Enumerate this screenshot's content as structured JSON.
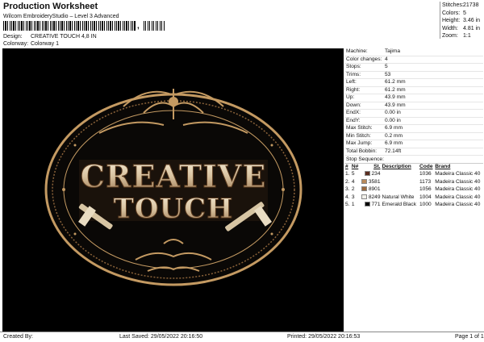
{
  "header": {
    "title": "Production Worksheet",
    "subtitle": "Wilcom EmbroideryStudio – Level 3 Advanced",
    "barcode_separator": ",",
    "design_label": "Design:",
    "design_value": "CREATIVE TOUCH 4,8 IN",
    "colorway_label": "Colorway:",
    "colorway_value": "Colorway 1"
  },
  "stats": [
    {
      "label": "Stitches:",
      "value": "21738"
    },
    {
      "label": "Colors:",
      "value": "5"
    },
    {
      "label": "Height:",
      "value": "3.46 in"
    },
    {
      "label": "Width:",
      "value": "4.81 in"
    },
    {
      "label": "Zoom:",
      "value": "1:1"
    }
  ],
  "design_image": {
    "line1": "CREATIVE",
    "line2": "TOUCH",
    "background": "#000000",
    "gold": "#c49a62",
    "cream": "#efe3c8"
  },
  "machine_info": [
    {
      "label": "Machine:",
      "value": "Tajima"
    },
    {
      "label": "Color changes:",
      "value": "4"
    },
    {
      "label": "Stops:",
      "value": "5"
    },
    {
      "label": "Trims:",
      "value": "53"
    },
    {
      "label": "Left:",
      "value": "61.2 mm"
    },
    {
      "label": "Right:",
      "value": "61.2 mm"
    },
    {
      "label": "Up:",
      "value": "43.9 mm"
    },
    {
      "label": "Down:",
      "value": "43.9 mm"
    },
    {
      "label": "EndX:",
      "value": "0.00 in"
    },
    {
      "label": "EndY:",
      "value": "0.00 in"
    },
    {
      "label": "Max Stitch:",
      "value": "6.9 mm"
    },
    {
      "label": "Min Stitch:",
      "value": "0.2 mm"
    },
    {
      "label": "Max Jump:",
      "value": "6.9 mm"
    },
    {
      "label": "Total Bobbin:",
      "value": "72.14ft"
    }
  ],
  "stop_sequence": {
    "label": "Stop Sequence:",
    "headers": [
      "#",
      "N#",
      "St.",
      "Description",
      "Code",
      "Brand"
    ],
    "rows": [
      {
        "num": "1.",
        "n": "5",
        "color": "#5a2d20",
        "st": "234",
        "desc": "",
        "code": "1036",
        "brand": "Madeira Classic 40"
      },
      {
        "num": "2.",
        "n": "4",
        "color": "#b98a5b",
        "st": "3581",
        "desc": "",
        "code": "1173",
        "brand": "Madeira Classic 40"
      },
      {
        "num": "3.",
        "n": "2",
        "color": "#9c6a3f",
        "st": "8901",
        "desc": "",
        "code": "1056",
        "brand": "Madeira Classic 40"
      },
      {
        "num": "4.",
        "n": "3",
        "color": "#f1f0ea",
        "st": "8249",
        "desc": "Natural White",
        "code": "1004",
        "brand": "Madeira Classic 40"
      },
      {
        "num": "5.",
        "n": "1",
        "color": "#050505",
        "st": "771",
        "desc": "Emerald Black",
        "code": "1000",
        "brand": "Madeira Classic 40"
      }
    ]
  },
  "footer": {
    "created_by": "Created By:",
    "last_saved": "Last Saved: 29/05/2022 20:16:50",
    "printed": "Printed: 29/05/2022 20:16:53",
    "page": "Page 1 of 1"
  }
}
